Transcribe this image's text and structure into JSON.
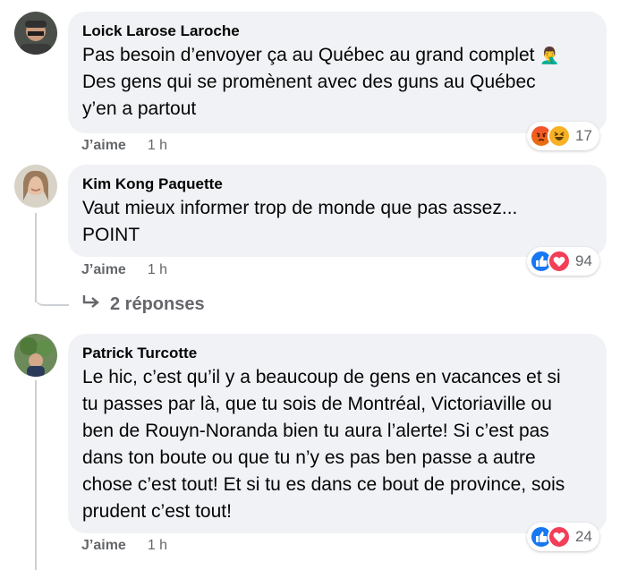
{
  "comments": [
    {
      "author": "Loick Larose Laroche",
      "lines": [
        "Pas besoin d’envoyer ça au Québec au grand complet",
        "Des gens qui se promènent avec des guns au Québec",
        "y’en a partout"
      ],
      "like_label": "J’aime",
      "time": "1 h",
      "reaction_count": "17",
      "reactions": [
        "angry-icon",
        "haha-icon"
      ]
    },
    {
      "author": "Kim Kong Paquette",
      "lines": [
        "Vaut mieux informer trop de monde que pas assez...",
        "POINT"
      ],
      "like_label": "J’aime",
      "time": "1 h",
      "reaction_count": "94",
      "reactions": [
        "like-icon",
        "love-icon"
      ],
      "replies_label": "2 réponses"
    },
    {
      "author": "Patrick Turcotte",
      "lines": [
        "Le hic, c’est qu’il y a beaucoup de gens en vacances et si",
        "tu passes par là, que tu sois de Montréal, Victoriaville ou",
        "ben de Rouyn-Noranda bien tu aura l’alerte! Si c’est pas",
        "dans ton boute ou que tu n’y es pas ben passe a autre",
        "chose c’est tout! Et si tu es dans ce bout de province, sois",
        "prudent c’est tout!"
      ],
      "like_label": "J’aime",
      "time": "1 h",
      "reaction_count": "24",
      "reactions": [
        "like-icon",
        "love-icon"
      ]
    }
  ],
  "colors": {
    "bubble": "#f0f2f5",
    "secondary_text": "#65676b",
    "like_blue": "#1877f2",
    "love_red": "#f33e58",
    "angry_orange": "#e9710f",
    "haha_yellow": "#f7b125"
  }
}
